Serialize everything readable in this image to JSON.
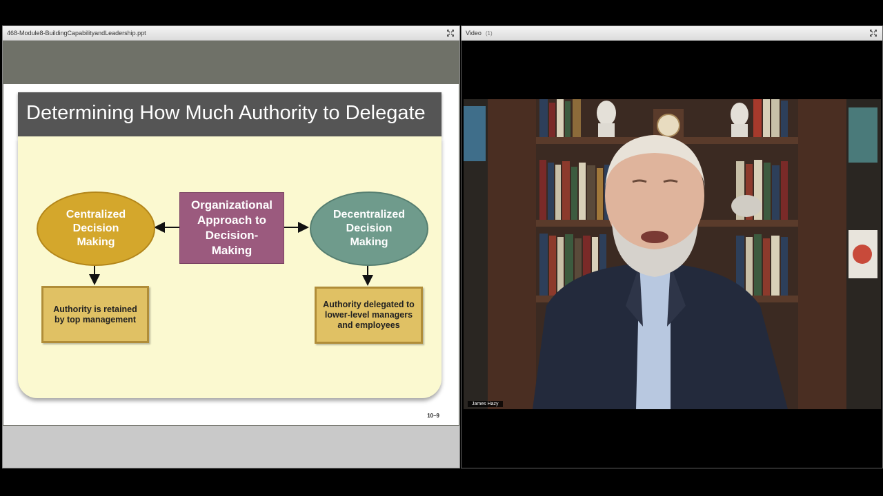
{
  "share_pod": {
    "title": "468-Module8-BuildingCapabilityandLeadership.ppt",
    "slide": {
      "title": "Determining How Much Authority to Delegate",
      "center_label": "Organizational Approach to Decision-Making",
      "left_label": "Centralized Decision Making",
      "right_label": "Decentralized Decision Making",
      "left_box": "Authority is retained by top management",
      "right_box": "Authority delegated to lower-level managers and employees",
      "number": "10–9",
      "colors": {
        "centralized": "#d4a72c",
        "decentralized": "#6f9b8c",
        "center": "#9b5a7e",
        "box": "#e0c164"
      }
    }
  },
  "video_pod": {
    "title": "Video",
    "count": "(1)",
    "presenter_name": "James Hazy"
  },
  "icons": {
    "maximize": "expand-icon"
  }
}
